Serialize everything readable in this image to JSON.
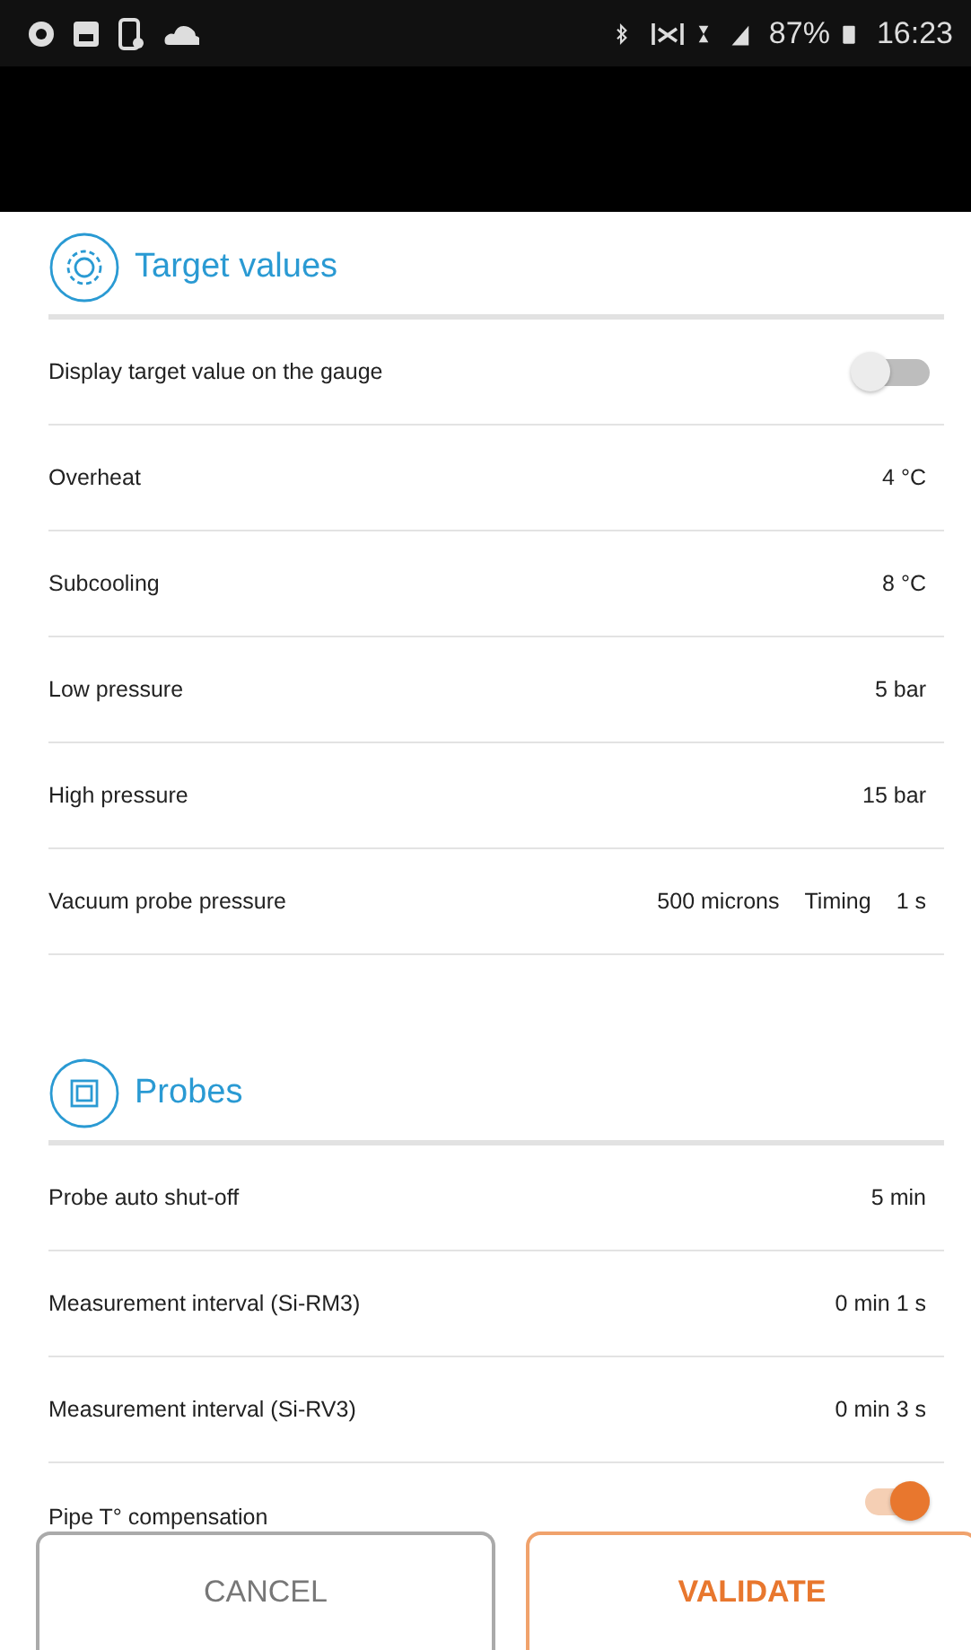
{
  "status_bar": {
    "battery": "87%",
    "time": "16:23"
  },
  "sections": [
    {
      "title": "Target values",
      "rows": [
        {
          "kind": "toggle",
          "label": "Display target value on the gauge",
          "on": false
        },
        {
          "kind": "value",
          "label": "Overheat",
          "values": [
            "4 °C"
          ]
        },
        {
          "kind": "value",
          "label": "Subcooling",
          "values": [
            "8 °C"
          ]
        },
        {
          "kind": "value",
          "label": "Low pressure",
          "values": [
            "5 bar"
          ]
        },
        {
          "kind": "value",
          "label": "High pressure",
          "values": [
            "15 bar"
          ]
        },
        {
          "kind": "value",
          "label": "Vacuum probe pressure",
          "values": [
            "500 microns",
            "Timing",
            "1 s"
          ]
        }
      ]
    },
    {
      "title": "Probes",
      "rows": [
        {
          "kind": "value",
          "label": "Probe auto shut-off",
          "values": [
            "5 min"
          ]
        },
        {
          "kind": "value",
          "label": "Measurement interval (Si-RM3)",
          "values": [
            "0 min 1 s"
          ]
        },
        {
          "kind": "value",
          "label": "Measurement interval (Si-RV3)",
          "values": [
            "0 min 3 s"
          ]
        },
        {
          "kind": "toggle",
          "label": "Pipe T° compensation",
          "on": true
        }
      ]
    }
  ],
  "buttons": [
    {
      "kind": "cancel",
      "label": "CANCEL"
    },
    {
      "kind": "validate",
      "label": "VALIDATE"
    }
  ]
}
